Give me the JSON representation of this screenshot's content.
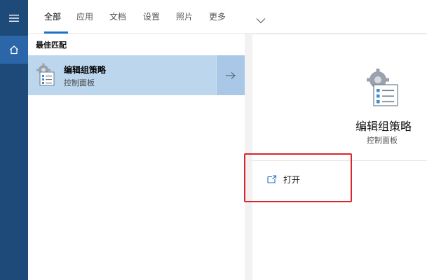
{
  "rail": {
    "menu_icon": "hamburger-icon",
    "home_icon": "home-icon"
  },
  "tabs": [
    {
      "label": "全部",
      "active": true
    },
    {
      "label": "应用",
      "active": false
    },
    {
      "label": "文档",
      "active": false
    },
    {
      "label": "设置",
      "active": false
    },
    {
      "label": "照片",
      "active": false
    },
    {
      "label": "更多",
      "active": false
    }
  ],
  "results": {
    "section_title": "最佳匹配",
    "best_match": {
      "title": "编辑组策略",
      "subtitle": "控制面板"
    }
  },
  "detail": {
    "title": "编辑组策略",
    "subtitle": "控制面板",
    "actions": [
      {
        "label": "打开",
        "icon": "open-icon"
      }
    ]
  },
  "colors": {
    "rail": "#1e4a7a",
    "rail_active": "#2a66a8",
    "selected_result": "#bcd6ee",
    "accent": "#1f6fc2",
    "highlight_box": "#d9262c"
  }
}
